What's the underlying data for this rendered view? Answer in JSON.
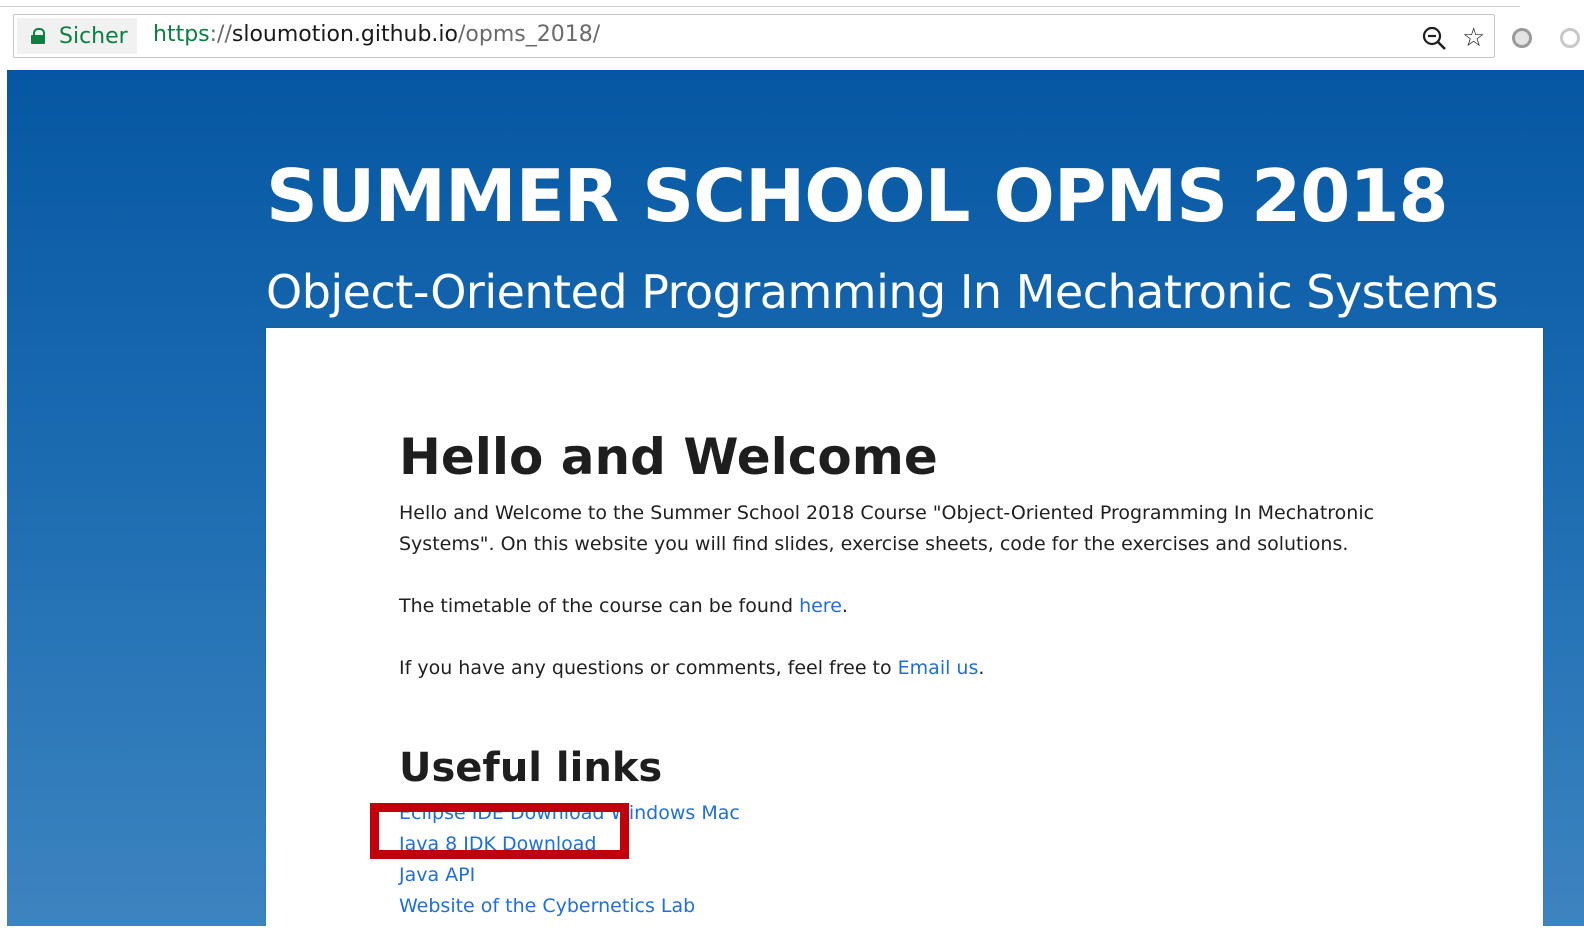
{
  "browser": {
    "secure_label": "Sicher",
    "url": {
      "scheme": "https",
      "separator": "://",
      "host": "sloumotion.github.io",
      "path": "/opms_2018/"
    },
    "icons": [
      "lock-icon",
      "zoom-icon",
      "bookmark-star-icon",
      "extension-icon"
    ]
  },
  "header": {
    "title": "SUMMER SCHOOL OPMS 2018",
    "subtitle": "Object-Oriented Programming In Mechatronic Systems"
  },
  "content": {
    "welcome_heading": "Hello and Welcome",
    "intro_text": "Hello and Welcome to the Summer School 2018 Course \"Object-Oriented Programming In Mechatronic Systems\". On this website you will find slides, exercise sheets, code for the exercises and solutions.",
    "timetable_prefix": "The timetable of the course can be found ",
    "timetable_link": "here",
    "timetable_suffix": ".",
    "contact_prefix": "If you have any questions or comments, feel free to ",
    "contact_link": "Email us",
    "contact_suffix": ".",
    "useful_links_heading": "Useful links",
    "links": [
      {
        "label": "Eclipse IDE Download",
        "extra": [
          " ",
          "Windows",
          " ",
          "Mac"
        ]
      },
      {
        "label": "Java 8 JDK Download"
      },
      {
        "label": "Java API"
      },
      {
        "label": "Website of the Cybernetics Lab"
      }
    ]
  },
  "colors": {
    "header_bg_top": "#0657a3",
    "header_bg_bottom": "#3d84c0",
    "link": "#1e6fd9",
    "secure_green": "#0b8043",
    "highlight_red": "#c0000b"
  }
}
